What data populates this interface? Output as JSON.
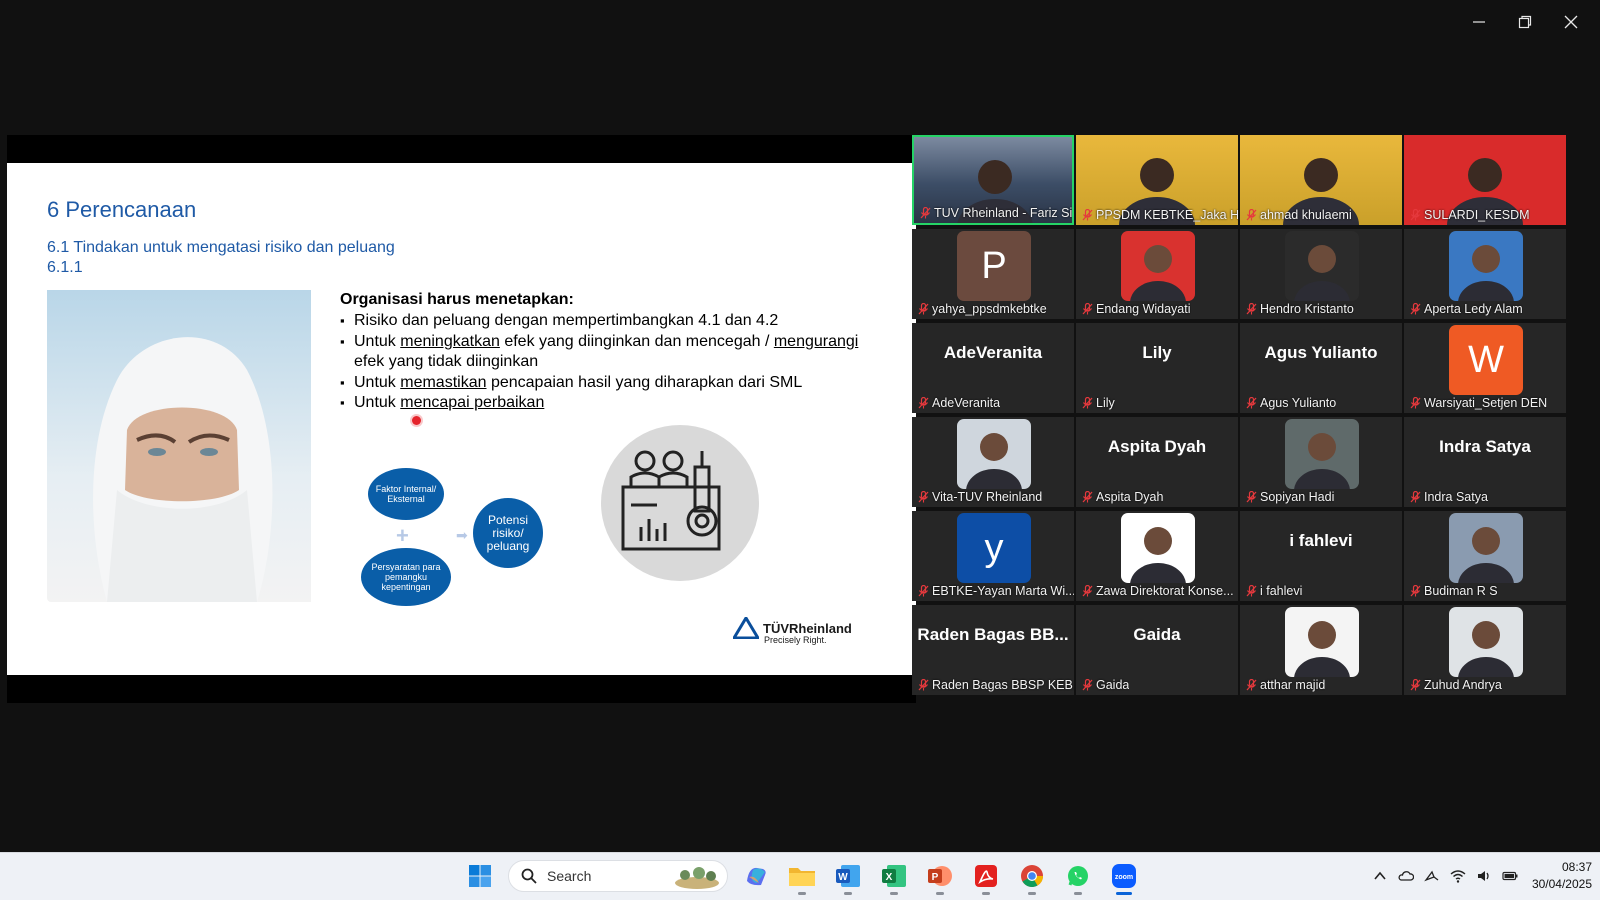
{
  "window_controls": {
    "minimize": "minimize-icon",
    "restore": "restore-icon",
    "close": "close-icon"
  },
  "slide": {
    "title": "6 Perencanaan",
    "subtitle_line1": "6.1 Tindakan untuk mengatasi risiko dan peluang",
    "subtitle_line2": "6.1.1",
    "heading": "Organisasi harus menetapkan:",
    "bullet1": "Risiko dan peluang dengan mempertimbangkan 4.1 dan 4.2",
    "bullet2_pre": "Untuk ",
    "bullet2_u1": "meningkatkan",
    "bullet2_mid": " efek yang diinginkan dan mencegah / ",
    "bullet2_u2": "mengurangi",
    "bullet2_post": " efek yang tidak diinginkan",
    "bullet3_pre": "Untuk ",
    "bullet3_u": "memastikan",
    "bullet3_post": " pencapaian hasil yang diharapkan dari SML",
    "bullet4_pre": "Untuk ",
    "bullet4_u": "mencapai perbaikan",
    "diagram_box1": "Faktor Internal/ Eksternal",
    "diagram_box2": "Persyaratan para pemangku kepentingan",
    "diagram_box3": "Potensi risiko/ peluang",
    "logo_name": "TÜVRheinland",
    "logo_tagline": "Precisely Right."
  },
  "participants": [
    {
      "name": "TUV Rheinland - Fariz Sih...",
      "type": "video",
      "speaking": true
    },
    {
      "name": "PPSDM KEBTKE_Jaka H...",
      "type": "video"
    },
    {
      "name": "ahmad khulaemi",
      "type": "video"
    },
    {
      "name": "SULARDI_KESDM",
      "type": "video"
    },
    {
      "name": "yahya_ppsdmkebtke",
      "type": "avatar",
      "initial": "P",
      "color": "#6b4a3e"
    },
    {
      "name": "Endang Widayati",
      "type": "photo",
      "color": "#d9322f"
    },
    {
      "name": "Hendro Kristanto",
      "type": "photo",
      "color": "#2b2b2b"
    },
    {
      "name": "Aperta Ledy Alam",
      "type": "photo",
      "color": "#3a78c2"
    },
    {
      "name": "AdeVeranita",
      "type": "text",
      "display": "AdeVeranita"
    },
    {
      "name": "Lily",
      "type": "text",
      "display": "Lily"
    },
    {
      "name": "Agus Yulianto",
      "type": "text",
      "display": "Agus Yulianto"
    },
    {
      "name": "Warsiyati_Setjen DEN",
      "type": "avatar",
      "initial": "W",
      "color": "#ef5a24"
    },
    {
      "name": "Vita-TUV Rheinland",
      "type": "photo",
      "color": "#cfd6dd"
    },
    {
      "name": "Aspita Dyah",
      "type": "text",
      "display": "Aspita Dyah"
    },
    {
      "name": "Sopiyan Hadi",
      "type": "photo",
      "color": "#5f6a6a"
    },
    {
      "name": "Indra Satya",
      "type": "text",
      "display": "Indra Satya"
    },
    {
      "name": "EBTKE-Yayan Marta Wi...",
      "type": "avatar",
      "initial": "y",
      "color": "#0d4ea6"
    },
    {
      "name": "Zawa Direktorat Konse...",
      "type": "photo",
      "color": "#ffffff"
    },
    {
      "name": "i fahlevi",
      "type": "text",
      "display": "i fahlevi"
    },
    {
      "name": "Budiman R S",
      "type": "photo",
      "color": "#8a9bb0"
    },
    {
      "name": "Raden Bagas BBSP KEB...",
      "type": "text",
      "display": "Raden Bagas BB..."
    },
    {
      "name": "Gaida",
      "type": "text",
      "display": "Gaida"
    },
    {
      "name": "atthar majid",
      "type": "photo",
      "color": "#f4f4f4"
    },
    {
      "name": "Zuhud Andrya",
      "type": "photo",
      "color": "#dfe3e6"
    }
  ],
  "taskbar": {
    "search_label": "Search",
    "apps": [
      "windows-start-icon",
      "copilot-icon",
      "file-explorer-icon",
      "word-icon",
      "excel-icon",
      "powerpoint-icon",
      "acrobat-icon",
      "chrome-icon",
      "whatsapp-icon",
      "zoom-icon"
    ],
    "time": "08:37",
    "date": "30/04/2025"
  }
}
